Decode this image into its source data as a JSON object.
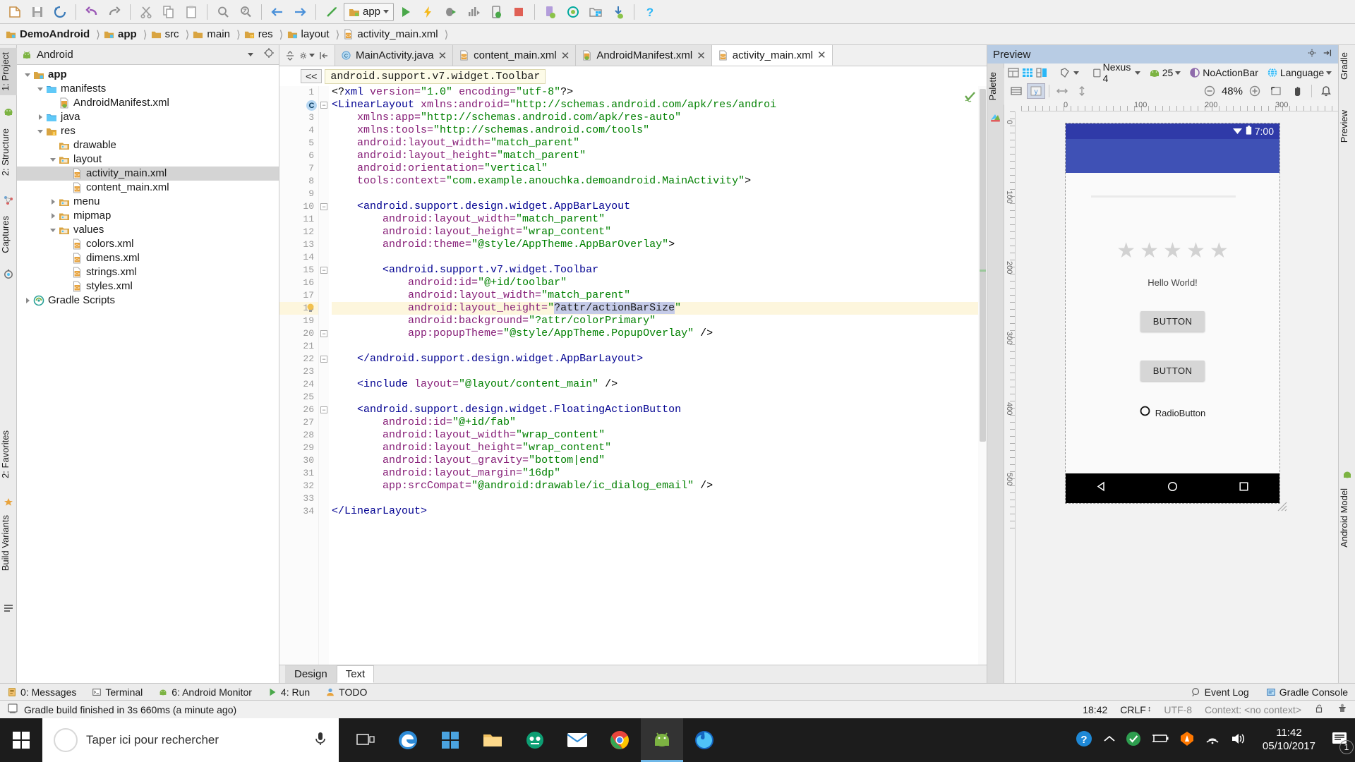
{
  "window": {
    "toolbar_icons": [
      "new-file-icon",
      "save-all-icon",
      "sync-icon",
      "undo-icon",
      "redo-icon",
      "cut-icon",
      "copy-icon",
      "paste-icon",
      "find-icon",
      "find-replace-icon",
      "back-icon",
      "forward-icon",
      "build-icon",
      "run-icon",
      "apply-changes-icon",
      "debug-icon",
      "profile-icon",
      "attach-debugger-icon",
      "stop-icon",
      "avd-manager-icon",
      "sdk-manager-icon",
      "project-structure-icon",
      "layout-inspector-icon",
      "sync-gradle-icon",
      "help-icon"
    ],
    "module_selector": "app"
  },
  "breadcrumb": {
    "items": [
      {
        "label": "DemoAndroid",
        "icon": "project-folder-icon",
        "bold": true
      },
      {
        "label": "app",
        "icon": "module-folder-icon",
        "bold": true
      },
      {
        "label": "src",
        "icon": "folder-icon",
        "bold": false
      },
      {
        "label": "main",
        "icon": "folder-icon",
        "bold": false
      },
      {
        "label": "res",
        "icon": "res-folder-icon",
        "bold": false
      },
      {
        "label": "layout",
        "icon": "layout-folder-icon",
        "bold": false
      },
      {
        "label": "activity_main.xml",
        "icon": "xml-file-icon",
        "bold": false
      }
    ]
  },
  "left_strip": {
    "tabs": [
      {
        "label": "1: Project",
        "selected": true
      },
      {
        "label": "2: Structure",
        "selected": false
      },
      {
        "label": "Captures",
        "selected": false
      },
      {
        "label": "2: Favorites",
        "selected": false
      },
      {
        "label": "Build Variants",
        "selected": false
      }
    ]
  },
  "right_strip": {
    "tabs": [
      {
        "label": "Gradle"
      },
      {
        "label": "Preview"
      },
      {
        "label": "Android Model"
      }
    ]
  },
  "project_panel": {
    "selector_label": "Android",
    "selector_icon": "android-icon",
    "locate_icon": "target-icon",
    "tree": [
      {
        "label": "app",
        "indent": 0,
        "arrow": "down",
        "icon": "module-icon",
        "bold": true,
        "selected": false
      },
      {
        "label": "manifests",
        "indent": 1,
        "arrow": "down",
        "icon": "folder-icon",
        "bold": false,
        "selected": false
      },
      {
        "label": "AndroidManifest.xml",
        "indent": 2,
        "arrow": "none",
        "icon": "manifest-icon",
        "bold": false,
        "selected": false
      },
      {
        "label": "java",
        "indent": 1,
        "arrow": "right",
        "icon": "folder-icon",
        "bold": false,
        "selected": false
      },
      {
        "label": "res",
        "indent": 1,
        "arrow": "down",
        "icon": "res-icon",
        "bold": false,
        "selected": false
      },
      {
        "label": "drawable",
        "indent": 2,
        "arrow": "none",
        "icon": "res-folder-icon",
        "bold": false,
        "selected": false
      },
      {
        "label": "layout",
        "indent": 2,
        "arrow": "down",
        "icon": "res-folder-icon",
        "bold": false,
        "selected": false
      },
      {
        "label": "activity_main.xml",
        "indent": 3,
        "arrow": "none",
        "icon": "xml-file-icon",
        "bold": false,
        "selected": true
      },
      {
        "label": "content_main.xml",
        "indent": 3,
        "arrow": "none",
        "icon": "xml-file-icon",
        "bold": false,
        "selected": false
      },
      {
        "label": "menu",
        "indent": 2,
        "arrow": "right",
        "icon": "res-folder-icon",
        "bold": false,
        "selected": false
      },
      {
        "label": "mipmap",
        "indent": 2,
        "arrow": "right",
        "icon": "res-folder-icon",
        "bold": false,
        "selected": false
      },
      {
        "label": "values",
        "indent": 2,
        "arrow": "down",
        "icon": "res-folder-icon",
        "bold": false,
        "selected": false
      },
      {
        "label": "colors.xml",
        "indent": 3,
        "arrow": "none",
        "icon": "xml-file-icon",
        "bold": false,
        "selected": false
      },
      {
        "label": "dimens.xml",
        "indent": 3,
        "arrow": "none",
        "icon": "xml-file-icon",
        "bold": false,
        "selected": false
      },
      {
        "label": "strings.xml",
        "indent": 3,
        "arrow": "none",
        "icon": "xml-file-icon",
        "bold": false,
        "selected": false
      },
      {
        "label": "styles.xml",
        "indent": 3,
        "arrow": "none",
        "icon": "xml-file-icon",
        "bold": false,
        "selected": false
      },
      {
        "label": "Gradle Scripts",
        "indent": 0,
        "arrow": "right",
        "icon": "gradle-icon",
        "bold": false,
        "selected": false
      }
    ]
  },
  "editor": {
    "tabs": [
      {
        "label": "MainActivity.java",
        "icon": "java-class-icon",
        "active": false
      },
      {
        "label": "content_main.xml",
        "icon": "xml-file-icon",
        "active": false
      },
      {
        "label": "AndroidManifest.xml",
        "icon": "manifest-icon",
        "active": false
      },
      {
        "label": "activity_main.xml",
        "icon": "xml-file-icon",
        "active": true
      }
    ],
    "breadcrumb_collapse": "<<",
    "breadcrumb_tag": "android.support.v7.widget.Toolbar",
    "highlighted_line": 18,
    "line_count": 34,
    "lines": [
      {
        "n": 1,
        "indent": 0,
        "segments": [
          {
            "t": "<?",
            "c": "punct"
          },
          {
            "t": "xml",
            "c": "tag"
          },
          {
            "t": " version=",
            "c": "attr"
          },
          {
            "t": "\"1.0\"",
            "c": "val"
          },
          {
            "t": " encoding=",
            "c": "attr"
          },
          {
            "t": "\"utf-8\"",
            "c": "val"
          },
          {
            "t": "?>",
            "c": "punct"
          }
        ]
      },
      {
        "n": 2,
        "indent": 0,
        "segments": [
          {
            "t": "<LinearLayout ",
            "c": "tag"
          },
          {
            "t": "xmlns:android=",
            "c": "attr"
          },
          {
            "t": "\"http://schemas.android.com/apk/res/androi",
            "c": "val"
          }
        ]
      },
      {
        "n": 3,
        "indent": 1,
        "segments": [
          {
            "t": "xmlns:app=",
            "c": "attr"
          },
          {
            "t": "\"http://schemas.android.com/apk/res-auto\"",
            "c": "val"
          }
        ]
      },
      {
        "n": 4,
        "indent": 1,
        "segments": [
          {
            "t": "xmlns:tools=",
            "c": "attr"
          },
          {
            "t": "\"http://schemas.android.com/tools\"",
            "c": "val"
          }
        ]
      },
      {
        "n": 5,
        "indent": 1,
        "segments": [
          {
            "t": "android:layout_width=",
            "c": "attr"
          },
          {
            "t": "\"match_parent\"",
            "c": "val"
          }
        ]
      },
      {
        "n": 6,
        "indent": 1,
        "segments": [
          {
            "t": "android:layout_height=",
            "c": "attr"
          },
          {
            "t": "\"match_parent\"",
            "c": "val"
          }
        ]
      },
      {
        "n": 7,
        "indent": 1,
        "segments": [
          {
            "t": "android:orientation=",
            "c": "attr"
          },
          {
            "t": "\"vertical\"",
            "c": "val"
          }
        ]
      },
      {
        "n": 8,
        "indent": 1,
        "segments": [
          {
            "t": "tools:context=",
            "c": "attr"
          },
          {
            "t": "\"com.example.anouchka.demoandroid.MainActivity\"",
            "c": "val"
          },
          {
            "t": ">",
            "c": "punct"
          }
        ]
      },
      {
        "n": 9,
        "indent": 0,
        "segments": []
      },
      {
        "n": 10,
        "indent": 1,
        "segments": [
          {
            "t": "<android.support.design.widget.AppBarLayout",
            "c": "tag"
          }
        ]
      },
      {
        "n": 11,
        "indent": 2,
        "segments": [
          {
            "t": "android:layout_width=",
            "c": "attr"
          },
          {
            "t": "\"match_parent\"",
            "c": "val"
          }
        ]
      },
      {
        "n": 12,
        "indent": 2,
        "segments": [
          {
            "t": "android:layout_height=",
            "c": "attr"
          },
          {
            "t": "\"wrap_content\"",
            "c": "val"
          }
        ]
      },
      {
        "n": 13,
        "indent": 2,
        "segments": [
          {
            "t": "android:theme=",
            "c": "attr"
          },
          {
            "t": "\"@style/AppTheme.AppBarOverlay\"",
            "c": "val"
          },
          {
            "t": ">",
            "c": "punct"
          }
        ]
      },
      {
        "n": 14,
        "indent": 0,
        "segments": []
      },
      {
        "n": 15,
        "indent": 2,
        "segments": [
          {
            "t": "<android.support.v7.widget.Toolbar",
            "c": "tag"
          }
        ]
      },
      {
        "n": 16,
        "indent": 3,
        "segments": [
          {
            "t": "android:id=",
            "c": "attr"
          },
          {
            "t": "\"@+id/toolbar\"",
            "c": "val"
          }
        ]
      },
      {
        "n": 17,
        "indent": 3,
        "segments": [
          {
            "t": "android:layout_width=",
            "c": "attr"
          },
          {
            "t": "\"match_parent\"",
            "c": "val"
          }
        ]
      },
      {
        "n": 18,
        "indent": 3,
        "segments": [
          {
            "t": "android:layout_height=",
            "c": "attr"
          },
          {
            "t": "\"",
            "c": "val"
          },
          {
            "t": "?attr/actionBarSize",
            "c": "sel"
          },
          {
            "t": "\"",
            "c": "val"
          }
        ]
      },
      {
        "n": 19,
        "indent": 3,
        "segments": [
          {
            "t": "android:background=",
            "c": "attr"
          },
          {
            "t": "\"?attr/colorPrimary\"",
            "c": "val"
          }
        ]
      },
      {
        "n": 20,
        "indent": 3,
        "segments": [
          {
            "t": "app:popupTheme=",
            "c": "attr"
          },
          {
            "t": "\"@style/AppTheme.PopupOverlay\"",
            "c": "val"
          },
          {
            "t": " />",
            "c": "punct"
          }
        ]
      },
      {
        "n": 21,
        "indent": 0,
        "segments": []
      },
      {
        "n": 22,
        "indent": 1,
        "segments": [
          {
            "t": "</android.support.design.widget.AppBarLayout>",
            "c": "tag"
          }
        ]
      },
      {
        "n": 23,
        "indent": 0,
        "segments": []
      },
      {
        "n": 24,
        "indent": 1,
        "segments": [
          {
            "t": "<include ",
            "c": "tag"
          },
          {
            "t": "layout=",
            "c": "attr"
          },
          {
            "t": "\"@layout/content_main\"",
            "c": "val"
          },
          {
            "t": " />",
            "c": "punct"
          }
        ]
      },
      {
        "n": 25,
        "indent": 0,
        "segments": []
      },
      {
        "n": 26,
        "indent": 1,
        "segments": [
          {
            "t": "<android.support.design.widget.FloatingActionButton",
            "c": "tag"
          }
        ]
      },
      {
        "n": 27,
        "indent": 2,
        "segments": [
          {
            "t": "android:id=",
            "c": "attr"
          },
          {
            "t": "\"@+id/fab\"",
            "c": "val"
          }
        ]
      },
      {
        "n": 28,
        "indent": 2,
        "segments": [
          {
            "t": "android:layout_width=",
            "c": "attr"
          },
          {
            "t": "\"wrap_content\"",
            "c": "val"
          }
        ]
      },
      {
        "n": 29,
        "indent": 2,
        "segments": [
          {
            "t": "android:layout_height=",
            "c": "attr"
          },
          {
            "t": "\"wrap_content\"",
            "c": "val"
          }
        ]
      },
      {
        "n": 30,
        "indent": 2,
        "segments": [
          {
            "t": "android:layout_gravity=",
            "c": "attr"
          },
          {
            "t": "\"bottom|end\"",
            "c": "val"
          }
        ]
      },
      {
        "n": 31,
        "indent": 2,
        "segments": [
          {
            "t": "android:layout_margin=",
            "c": "attr"
          },
          {
            "t": "\"16dp\"",
            "c": "val"
          }
        ]
      },
      {
        "n": 32,
        "indent": 2,
        "segments": [
          {
            "t": "app:srcCompat=",
            "c": "attr"
          },
          {
            "t": "\"@android:drawable/ic_dialog_email\"",
            "c": "val"
          },
          {
            "t": " />",
            "c": "punct"
          }
        ]
      },
      {
        "n": 33,
        "indent": 0,
        "segments": []
      },
      {
        "n": 34,
        "indent": 0,
        "segments": [
          {
            "t": "</LinearLayout>",
            "c": "tag"
          }
        ]
      }
    ],
    "mode_tabs": [
      {
        "label": "Design",
        "selected": false
      },
      {
        "label": "Text",
        "selected": true
      }
    ]
  },
  "preview": {
    "title": "Preview",
    "palette_label": "Palette",
    "toolbar_row1": [
      {
        "icon": "render-mode-icon",
        "label": "",
        "active": false
      },
      {
        "icon": "blueprint-mode-icon",
        "label": "",
        "active": false
      },
      {
        "icon": "both-mode-icon",
        "label": "",
        "active": false
      },
      {
        "icon": "orientation-icon",
        "label": "",
        "active": false
      },
      {
        "icon": "device-icon",
        "label": "Nexus 4",
        "active": false
      },
      {
        "icon": "api-level-icon",
        "label": "25",
        "active": false
      },
      {
        "icon": "theme-icon",
        "label": "NoActionBar",
        "active": false
      },
      {
        "icon": "language-icon",
        "label": "Language",
        "active": false
      },
      {
        "icon": "layout-variants-icon",
        "label": "",
        "active": false
      }
    ],
    "toolbar_row2_left": [
      {
        "icon": "list-view-icon",
        "active": false
      },
      {
        "icon": "blueprint-y-icon",
        "active": true
      },
      {
        "icon": "resize-horizontal-icon",
        "active": false
      },
      {
        "icon": "resize-vertical-icon",
        "active": false
      }
    ],
    "zoom_level": "48%",
    "toolbar_row2_right": [
      {
        "icon": "zoom-out-icon"
      },
      {
        "icon": "zoom-in-icon"
      },
      {
        "icon": "zoom-fit-icon"
      },
      {
        "icon": "pan-hand-icon"
      },
      {
        "icon": "notification-bell-icon"
      }
    ],
    "ruler_labels_h": [
      "0",
      "100",
      "200",
      "300"
    ],
    "ruler_labels_v": [
      "0",
      "100",
      "200",
      "300",
      "400",
      "500"
    ],
    "device_render": {
      "status_time": "7:00",
      "status_icons": [
        "wifi-icon",
        "battery-icon"
      ],
      "rating_stars": 5,
      "hello_text": "Hello World!",
      "buttons": [
        "BUTTON",
        "BUTTON"
      ],
      "radio_label": "RadioButton",
      "nav_icons": [
        "back-triangle-icon",
        "home-circle-icon",
        "recents-square-icon"
      ],
      "colors": {
        "status_bar": "#2f3aa8",
        "app_bar": "#3f51b5",
        "background": "#fafafa",
        "nav_bar": "#000000",
        "button": "#d6d6d6",
        "star": "#d2d2d2"
      }
    }
  },
  "tool_windows": {
    "left_items": [
      {
        "label": "0: Messages",
        "icon": "messages-icon",
        "mnemonic": "0"
      },
      {
        "label": "Terminal",
        "icon": "terminal-icon",
        "mnemonic": ""
      },
      {
        "label": "6: Android Monitor",
        "icon": "android-monitor-icon",
        "mnemonic": "6"
      },
      {
        "label": "4: Run",
        "icon": "run-icon",
        "mnemonic": "4"
      },
      {
        "label": "TODO",
        "icon": "todo-icon",
        "mnemonic": ""
      }
    ],
    "right_items": [
      {
        "label": "Event Log",
        "icon": "event-log-icon"
      },
      {
        "label": "Gradle Console",
        "icon": "gradle-console-icon"
      }
    ]
  },
  "status_bar": {
    "message": "Gradle build finished in 3s 660ms (a minute ago)",
    "message_icon": "build-status-icon",
    "time": "18:42",
    "line_separator": "CRLF",
    "encoding": "UTF-8",
    "context": "Context: <no context>",
    "lock_icon": "unlocked-icon",
    "inspector_icon": "hector-inspector-icon"
  },
  "taskbar": {
    "start_icon": "windows-start-icon",
    "search_placeholder": "Taper ici pour rechercher",
    "search_icons": [
      "cortana-circle-icon",
      "microphone-icon"
    ],
    "apps": [
      {
        "icon": "task-view-icon",
        "active": false
      },
      {
        "icon": "edge-icon",
        "active": false
      },
      {
        "icon": "store-icon",
        "active": false
      },
      {
        "icon": "file-explorer-icon",
        "active": false
      },
      {
        "icon": "dropbox-icon",
        "active": false
      },
      {
        "icon": "mail-icon",
        "active": false
      },
      {
        "icon": "chrome-icon",
        "active": false
      },
      {
        "icon": "android-studio-icon",
        "active": true
      },
      {
        "icon": "firefox-icon",
        "active": false
      }
    ],
    "tray": [
      {
        "icon": "help-question-icon"
      },
      {
        "icon": "show-hidden-icons-icon"
      },
      {
        "icon": "security-shield-icon"
      },
      {
        "icon": "battery-charging-icon"
      },
      {
        "icon": "avast-icon"
      },
      {
        "icon": "wifi-signal-icon"
      },
      {
        "icon": "volume-icon"
      }
    ],
    "clock_time": "11:42",
    "clock_date": "05/10/2017",
    "notification_icon": "action-center-icon",
    "notification_count": "1"
  }
}
